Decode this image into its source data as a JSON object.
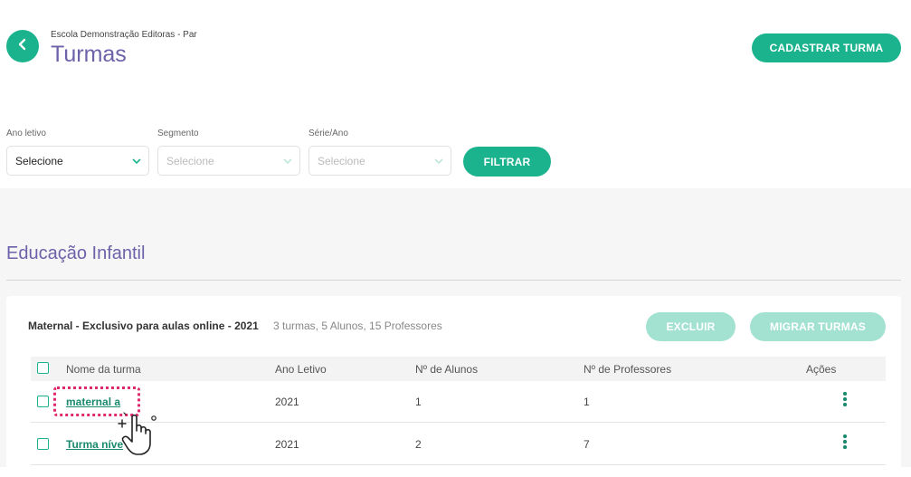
{
  "header": {
    "school_name": "Escola Demonstração Editoras - Par",
    "page_title": "Turmas",
    "create_button_label": "CADASTRAR TURMA"
  },
  "filters": {
    "ano_letivo": {
      "label": "Ano letivo",
      "value": "Selecione"
    },
    "segmento": {
      "label": "Segmento",
      "value": "Selecione"
    },
    "serie_ano": {
      "label": "Série/Ano",
      "value": "Selecione"
    },
    "filter_button_label": "FILTRAR"
  },
  "section": {
    "title": "Educação Infantil",
    "group": {
      "title": "Maternal - Exclusivo para aulas online - 2021",
      "info": "3 turmas, 5 Alunos, 15 Professores",
      "delete_label": "EXCLUIR",
      "migrate_label": "MIGRAR TURMAS"
    },
    "table": {
      "columns": [
        "Nome da turma",
        "Ano Letivo",
        "Nº de Alunos",
        "Nº de Professores",
        "Ações"
      ],
      "rows": [
        {
          "name": "maternal a",
          "year": "2021",
          "students": "1",
          "teachers": "1"
        },
        {
          "name": "Turma níve",
          "year": "2021",
          "students": "2",
          "teachers": "7"
        }
      ]
    }
  },
  "colors": {
    "accent": "#1bb38d",
    "accent_light": "#a3e2d0",
    "title": "#6b62a9",
    "highlight": "#e0296d"
  },
  "icons": {
    "back": "chevron-left-icon",
    "select": "chevron-down-icon",
    "actions": "kebab-menu-icon",
    "cursor": "hand-pointer-icon"
  }
}
